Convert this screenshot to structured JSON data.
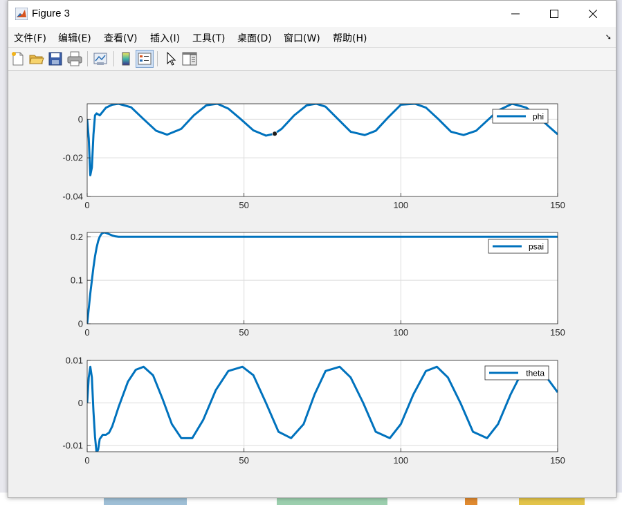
{
  "window": {
    "title": "Figure 3",
    "controls": [
      "minimize",
      "maximize",
      "close"
    ]
  },
  "menu": {
    "items": [
      {
        "label": "文件(F)"
      },
      {
        "label": "编辑(E)"
      },
      {
        "label": "查看(V)"
      },
      {
        "label": "插入(I)"
      },
      {
        "label": "工具(T)"
      },
      {
        "label": "桌面(D)"
      },
      {
        "label": "窗口(W)"
      },
      {
        "label": "帮助(H)"
      }
    ]
  },
  "toolbar": {
    "icons": [
      "new-figure-icon",
      "open-file-icon",
      "save-icon",
      "print-icon",
      "link-plot-icon",
      "colorbar-icon",
      "legend-icon",
      "pointer-icon",
      "property-inspector-icon"
    ]
  },
  "colors": {
    "line": "#0072BD",
    "axes_bg": "#ffffff",
    "grid": "#dcdcdc",
    "figure_bg": "#f0f0f0"
  },
  "chart_data": [
    {
      "type": "line",
      "legend": "phi",
      "legend_position": "top-right",
      "xlim": [
        0,
        150
      ],
      "ylim": [
        -0.04,
        0.008
      ],
      "xticks": [
        0,
        50,
        100,
        150
      ],
      "yticks": [
        0,
        -0.02,
        -0.04
      ],
      "xtick_labels": [
        "0",
        "50",
        "100",
        "150"
      ],
      "ytick_labels": [
        "0",
        "-0.02",
        "-0.04"
      ],
      "grid": true,
      "series": [
        {
          "name": "phi",
          "x": [
            0,
            0.5,
            1,
            1.5,
            2,
            2.5,
            3,
            4,
            5,
            6,
            8,
            10,
            14,
            18,
            22,
            25.5,
            30,
            34,
            38,
            41.5,
            45,
            49,
            53,
            57,
            59.8,
            62,
            66,
            70,
            73,
            76,
            80,
            84,
            88.5,
            92,
            96,
            100,
            104.5,
            108,
            112,
            116,
            120,
            124,
            128,
            131,
            135.5,
            140,
            144,
            147,
            150
          ],
          "y": [
            0,
            -0.01,
            -0.029,
            -0.025,
            -0.008,
            0.002,
            0.003,
            0.002,
            0.004,
            0.006,
            0.0075,
            0.008,
            0.0062,
            0.0,
            -0.006,
            -0.008,
            -0.005,
            0.002,
            0.0072,
            0.008,
            0.0055,
            0.0,
            -0.0058,
            -0.0085,
            -0.0075,
            -0.005,
            0.002,
            0.0072,
            0.008,
            0.0065,
            0.0,
            -0.0065,
            -0.0082,
            -0.006,
            0.001,
            0.0075,
            0.008,
            0.006,
            0.0,
            -0.0065,
            -0.0082,
            -0.006,
            0.0,
            0.0045,
            0.008,
            0.006,
            0.001,
            -0.0035,
            -0.0078
          ]
        }
      ],
      "marker": {
        "x": 59.8,
        "y": -0.0075
      }
    },
    {
      "type": "line",
      "legend": "psai",
      "legend_position": "top-right",
      "xlim": [
        0,
        150
      ],
      "ylim": [
        0,
        0.21
      ],
      "xticks": [
        0,
        50,
        100,
        150
      ],
      "yticks": [
        0,
        0.1,
        0.2
      ],
      "xtick_labels": [
        "0",
        "50",
        "100",
        "150"
      ],
      "ytick_labels": [
        "0",
        "0.1",
        "0.2"
      ],
      "grid": true,
      "series": [
        {
          "name": "psai",
          "x": [
            0,
            0.5,
            1,
            1.5,
            2,
            2.5,
            3,
            3.5,
            4,
            4.5,
            5,
            5.5,
            6,
            7,
            8,
            9,
            10,
            12,
            15,
            20,
            40,
            80,
            120,
            150
          ],
          "y": [
            0,
            0.035,
            0.07,
            0.1,
            0.13,
            0.155,
            0.175,
            0.19,
            0.2,
            0.206,
            0.209,
            0.21,
            0.209,
            0.206,
            0.203,
            0.201,
            0.2,
            0.2,
            0.2,
            0.2,
            0.2,
            0.2,
            0.2,
            0.2
          ]
        }
      ]
    },
    {
      "type": "line",
      "legend": "theta",
      "legend_position": "top-right",
      "xlim": [
        0,
        150
      ],
      "ylim": [
        -0.0115,
        0.01
      ],
      "xticks": [
        0,
        50,
        100,
        150
      ],
      "yticks": [
        0.01,
        0,
        -0.01
      ],
      "xtick_labels": [
        "0",
        "50",
        "100",
        "150"
      ],
      "ytick_labels": [
        "0.01",
        "0",
        "-0.01"
      ],
      "grid": true,
      "series": [
        {
          "name": "theta",
          "x": [
            0,
            0.5,
            1,
            1.5,
            2,
            2.5,
            3,
            3.5,
            4,
            5,
            6,
            7,
            8,
            10,
            13,
            15.5,
            18,
            21,
            24,
            27,
            30,
            33.5,
            37,
            41,
            45,
            49.5,
            53,
            57,
            61,
            65,
            69,
            72.5,
            76,
            80.5,
            84,
            88,
            92,
            96.5,
            100,
            104,
            108,
            111.5,
            115,
            119,
            123,
            127.5,
            131,
            135,
            139,
            143,
            146,
            148,
            150
          ],
          "y": [
            0,
            0.006,
            0.0085,
            0.006,
            -0.002,
            -0.008,
            -0.0118,
            -0.011,
            -0.0085,
            -0.0075,
            -0.0075,
            -0.007,
            -0.0055,
            -0.001,
            0.005,
            0.0078,
            0.0085,
            0.0065,
            0.001,
            -0.005,
            -0.0083,
            -0.0083,
            -0.004,
            0.003,
            0.0075,
            0.0085,
            0.0065,
            0.0,
            -0.0068,
            -0.0083,
            -0.005,
            0.002,
            0.0075,
            0.0085,
            0.006,
            0.0,
            -0.0068,
            -0.0083,
            -0.005,
            0.002,
            0.0075,
            0.0085,
            0.006,
            0.0,
            -0.0068,
            -0.0083,
            -0.005,
            0.002,
            0.0078,
            0.0083,
            0.0065,
            0.0045,
            0.0025
          ]
        }
      ]
    }
  ]
}
